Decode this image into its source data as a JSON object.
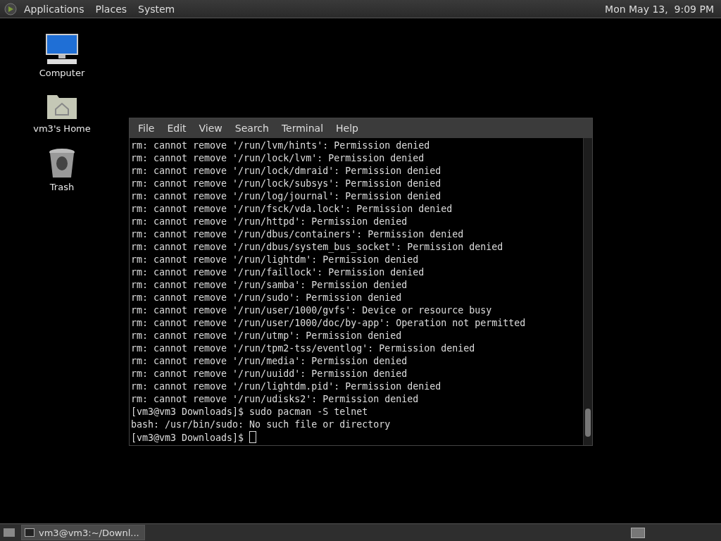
{
  "top_panel": {
    "menus": [
      "Applications",
      "Places",
      "System"
    ],
    "clock": "Mon May 13,  9:09 PM"
  },
  "desktop_icons": [
    {
      "kind": "computer",
      "label": "Computer"
    },
    {
      "kind": "home",
      "label": "vm3's Home"
    },
    {
      "kind": "trash",
      "label": "Trash"
    }
  ],
  "terminal": {
    "menu": [
      "File",
      "Edit",
      "View",
      "Search",
      "Terminal",
      "Help"
    ],
    "lines": [
      "rm: cannot remove '/run/lvm/hints': Permission denied",
      "rm: cannot remove '/run/lock/lvm': Permission denied",
      "rm: cannot remove '/run/lock/dmraid': Permission denied",
      "rm: cannot remove '/run/lock/subsys': Permission denied",
      "rm: cannot remove '/run/log/journal': Permission denied",
      "rm: cannot remove '/run/fsck/vda.lock': Permission denied",
      "rm: cannot remove '/run/httpd': Permission denied",
      "rm: cannot remove '/run/dbus/containers': Permission denied",
      "rm: cannot remove '/run/dbus/system_bus_socket': Permission denied",
      "rm: cannot remove '/run/lightdm': Permission denied",
      "rm: cannot remove '/run/faillock': Permission denied",
      "rm: cannot remove '/run/samba': Permission denied",
      "rm: cannot remove '/run/sudo': Permission denied",
      "rm: cannot remove '/run/user/1000/gvfs': Device or resource busy",
      "rm: cannot remove '/run/user/1000/doc/by-app': Operation not permitted",
      "rm: cannot remove '/run/utmp': Permission denied",
      "rm: cannot remove '/run/tpm2-tss/eventlog': Permission denied",
      "rm: cannot remove '/run/media': Permission denied",
      "rm: cannot remove '/run/uuidd': Permission denied",
      "rm: cannot remove '/run/lightdm.pid': Permission denied",
      "rm: cannot remove '/run/udisks2': Permission denied",
      "[vm3@vm3 Downloads]$ sudo pacman -S telnet",
      "bash: /usr/bin/sudo: No such file or directory"
    ],
    "prompt": "[vm3@vm3 Downloads]$"
  },
  "taskbar": {
    "windows": [
      {
        "label": "vm3@vm3:~/Downl...",
        "selected": true
      }
    ]
  }
}
